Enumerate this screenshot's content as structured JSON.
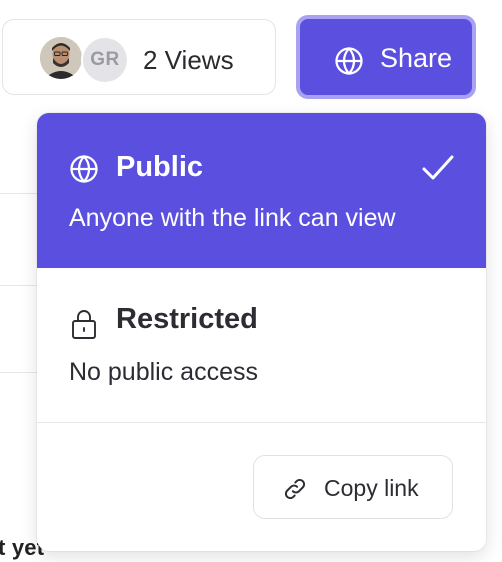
{
  "header": {
    "views": {
      "avatar_photo_alt": "user-photo",
      "avatar_initials": "GR",
      "label": "2 Views"
    },
    "share_button": {
      "label": "Share",
      "icon": "globe-icon"
    }
  },
  "share_menu": {
    "options": [
      {
        "title": "Public",
        "description": "Anyone with the link can view",
        "icon": "globe-icon",
        "selected": true
      },
      {
        "title": "Restricted",
        "description": "No public access",
        "icon": "lock-icon",
        "selected": false
      }
    ],
    "copy_link": {
      "label": "Copy link",
      "icon": "link-icon"
    }
  },
  "background": {
    "partial_text": "t yet"
  },
  "colors": {
    "accent": "#5b4fe0",
    "accent_ring": "#a9a2f3",
    "text": "#2c2c33",
    "border": "#e3e3e8"
  }
}
